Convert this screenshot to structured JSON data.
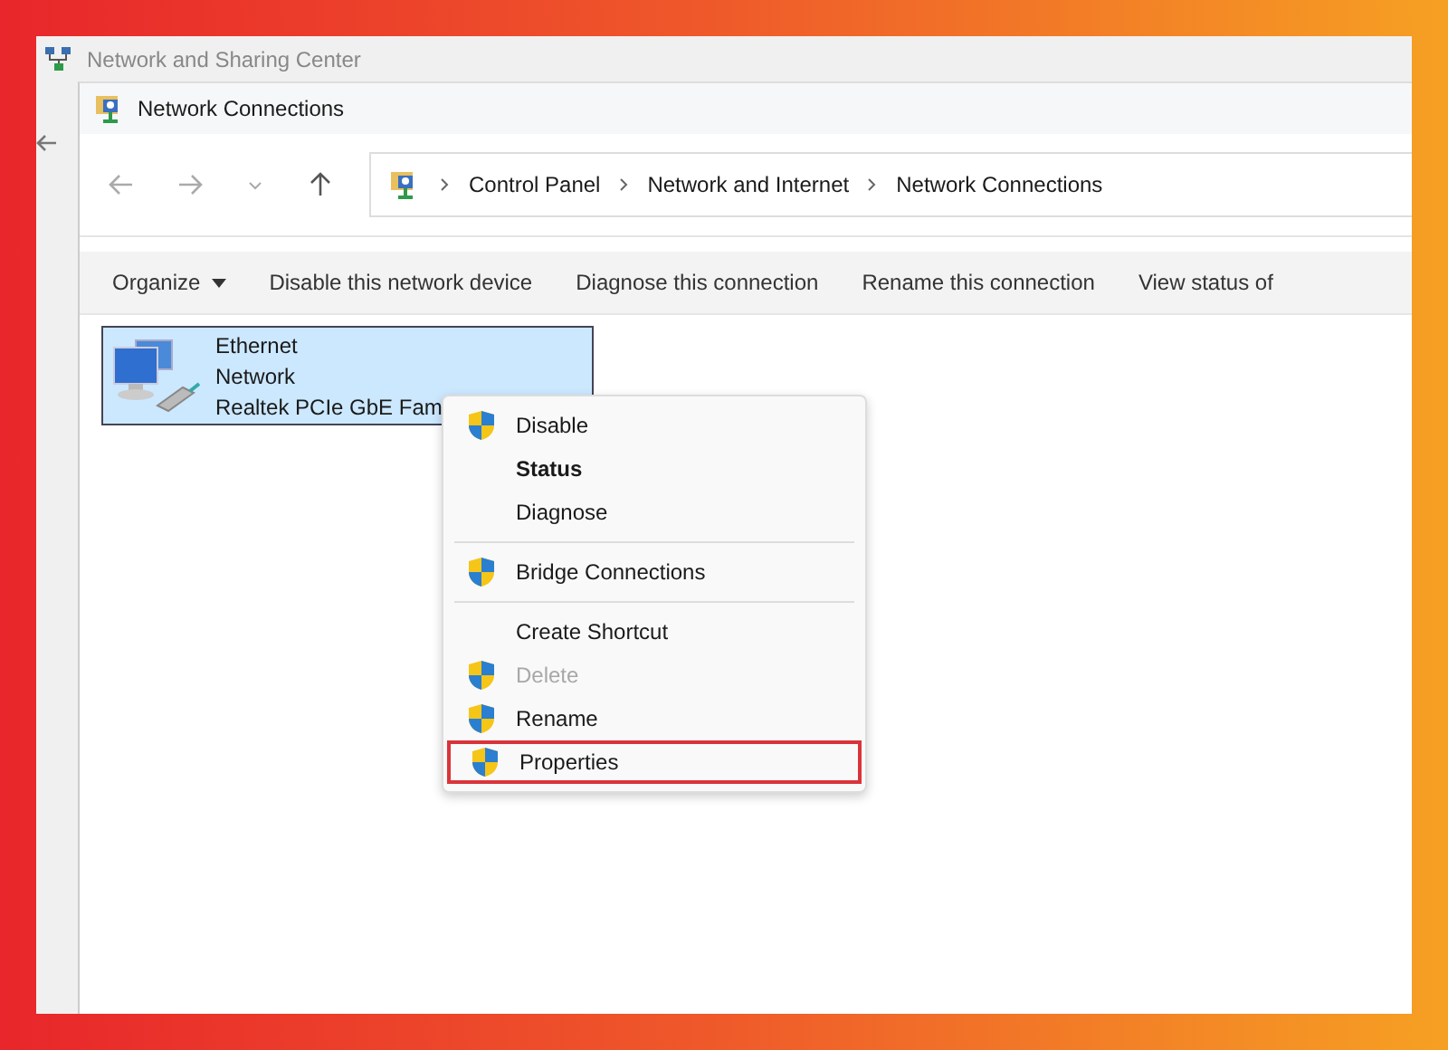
{
  "back_window": {
    "title": "Network and Sharing Center"
  },
  "window": {
    "title": "Network Connections"
  },
  "breadcrumb": [
    "Control Panel",
    "Network and Internet",
    "Network Connections"
  ],
  "toolbar": [
    {
      "label": "Organize",
      "dropdown": true
    },
    {
      "label": "Disable this network device",
      "dropdown": false
    },
    {
      "label": "Diagnose this connection",
      "dropdown": false
    },
    {
      "label": "Rename this connection",
      "dropdown": false
    },
    {
      "label": "View status of",
      "dropdown": false
    }
  ],
  "connections": [
    {
      "name": "Ethernet",
      "status": "Network",
      "device": "Realtek PCIe GbE Fam",
      "selected": true
    }
  ],
  "context_menu": [
    [
      {
        "label": "Disable",
        "shield": true,
        "bold": false,
        "disabled": false,
        "highlighted": false
      },
      {
        "label": "Status",
        "shield": false,
        "bold": true,
        "disabled": false,
        "highlighted": false
      },
      {
        "label": "Diagnose",
        "shield": false,
        "bold": false,
        "disabled": false,
        "highlighted": false
      }
    ],
    [
      {
        "label": "Bridge Connections",
        "shield": true,
        "bold": false,
        "disabled": false,
        "highlighted": false
      }
    ],
    [
      {
        "label": "Create Shortcut",
        "shield": false,
        "bold": false,
        "disabled": false,
        "highlighted": false
      },
      {
        "label": "Delete",
        "shield": true,
        "bold": false,
        "disabled": true,
        "highlighted": false
      },
      {
        "label": "Rename",
        "shield": true,
        "bold": false,
        "disabled": false,
        "highlighted": false
      },
      {
        "label": "Properties",
        "shield": true,
        "bold": false,
        "disabled": false,
        "highlighted": true
      }
    ]
  ]
}
